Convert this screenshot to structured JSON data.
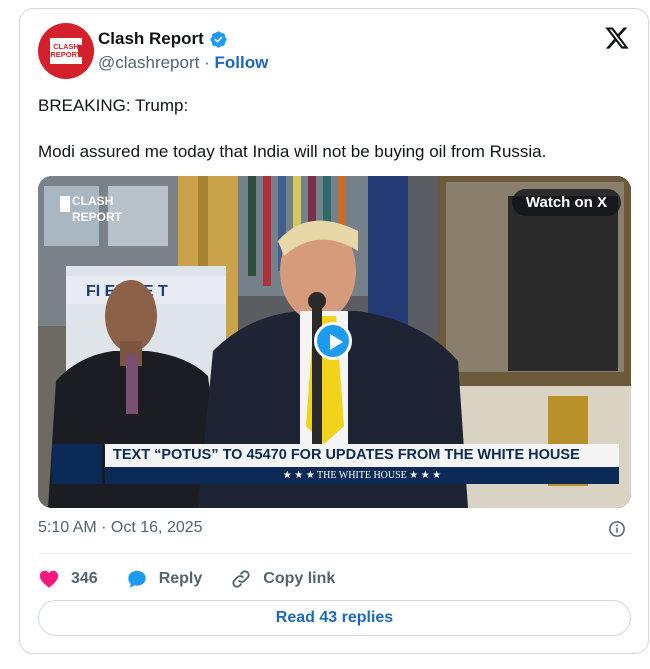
{
  "author": {
    "avatar_text_line1": "CLASH",
    "avatar_text_line2": "REPORT",
    "name": "Clash Report",
    "handle": "@clashreport",
    "separator": "·",
    "follow_label": "Follow"
  },
  "tweet": {
    "line1": "BREAKING: Trump:",
    "line2": "Modi assured me today that India will not be buying oil from Russia."
  },
  "media": {
    "watch_label": "Watch on X",
    "overlay_logo_line1": "CLASH",
    "overlay_logo_line2": "REPORT",
    "chyron_text": "TEXT “POTUS” TO 45470 FOR UPDATES FROM THE WHITE HOUSE",
    "chyron_sub": "★ ★ ★   THE WHITE HOUSE   ★ ★ ★",
    "backdrop_sign": "FI   ER HE  T",
    "tie_color": "#f2d21b",
    "play_color": "#1d9bf0"
  },
  "meta": {
    "timestamp": "5:10 AM · Oct 16, 2025"
  },
  "actions": {
    "likes": "346",
    "reply_label": "Reply",
    "copy_label": "Copy link"
  },
  "footer": {
    "read_replies": "Read 43 replies"
  },
  "colors": {
    "brand_red": "#d3202a",
    "link_blue": "#1d69b9",
    "like_pink": "#f91880",
    "verified_blue": "#1d9bf0"
  }
}
